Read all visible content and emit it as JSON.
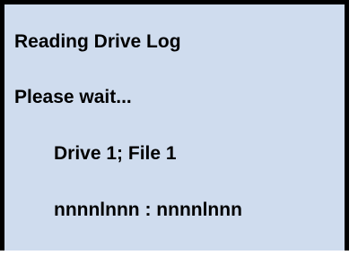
{
  "screen": {
    "title": "Reading Drive Log",
    "status": "Please wait...",
    "drive_file": "Drive 1; File 1",
    "progress_counter": "nnnnlnnn : nnnnlnnn"
  },
  "colors": {
    "background": "#cfdcee",
    "border": "#000000",
    "text": "#000000"
  }
}
